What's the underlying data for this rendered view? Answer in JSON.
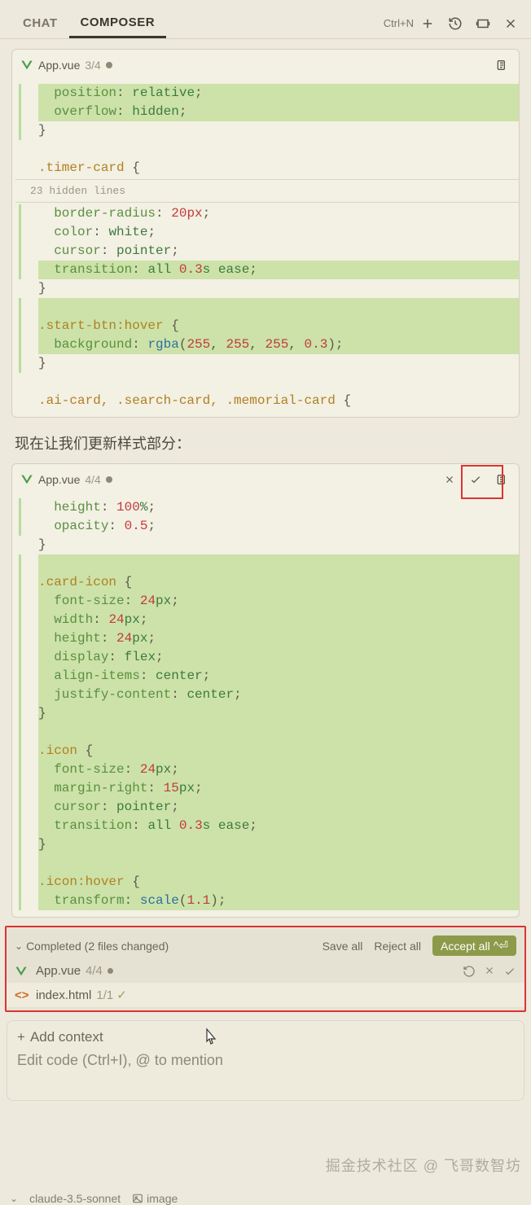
{
  "tabs": {
    "chat": "CHAT",
    "composer": "COMPOSER"
  },
  "shortcuts": {
    "new": "Ctrl+N"
  },
  "panel1": {
    "filename": "App.vue",
    "step": "3/4",
    "code": {
      "l1": {
        "p": "position",
        "v": "relative"
      },
      "l2": {
        "p": "overflow",
        "v": "hidden"
      },
      "sel1": ".timer-card",
      "hidden": "23 hidden lines",
      "l3": {
        "p": "border-radius",
        "v": "20px"
      },
      "l4": {
        "p": "color",
        "v": "white"
      },
      "l5": {
        "p": "cursor",
        "v": "pointer"
      },
      "l6": {
        "p": "transition",
        "a": "all",
        "n": "0.3",
        "u": "s",
        "e": "ease"
      },
      "sel2": ".start-btn:hover",
      "l7": {
        "p": "background",
        "fn": "rgba",
        "a1": "255",
        "a2": "255",
        "a3": "255",
        "a4": "0.3"
      },
      "sel3": ".ai-card, .search-card, .memorial-card"
    }
  },
  "message": "现在让我们更新样式部分：",
  "panel2": {
    "filename": "App.vue",
    "step": "4/4",
    "code": {
      "l1": {
        "p": "height",
        "n": "100",
        "u": "%"
      },
      "l2": {
        "p": "opacity",
        "n": "0.5"
      },
      "sel1": ".card-icon",
      "l3": {
        "p": "font-size",
        "n": "24",
        "u": "px"
      },
      "l4": {
        "p": "width",
        "n": "24",
        "u": "px"
      },
      "l5": {
        "p": "height",
        "n": "24",
        "u": "px"
      },
      "l6": {
        "p": "display",
        "v": "flex"
      },
      "l7": {
        "p": "align-items",
        "v": "center"
      },
      "l8": {
        "p": "justify-content",
        "v": "center"
      },
      "sel2": ".icon",
      "l9": {
        "p": "font-size",
        "n": "24",
        "u": "px"
      },
      "l10": {
        "p": "margin-right",
        "n": "15",
        "u": "px"
      },
      "l11": {
        "p": "cursor",
        "v": "pointer"
      },
      "l12": {
        "p": "transition",
        "a": "all",
        "n": "0.3",
        "u": "s",
        "e": "ease"
      },
      "sel3": ".icon:hover",
      "l13": {
        "p": "transform",
        "fn": "scale",
        "a1": "1.1"
      }
    }
  },
  "completed": {
    "title": "Completed",
    "count": "(2 files changed)",
    "save": "Save all",
    "reject": "Reject all",
    "accept": "Accept all",
    "accept_kbd": "^⏎",
    "files": [
      {
        "name": "App.vue",
        "count": "4/4"
      },
      {
        "name": "index.html",
        "count": "1/1"
      }
    ]
  },
  "input": {
    "add_context": "Add context",
    "placeholder": "Edit code (Ctrl+I), @ to mention",
    "model": "claude-3.5-sonnet",
    "image": "image"
  },
  "watermark": "掘金技术社区 @ 飞哥数智坊"
}
